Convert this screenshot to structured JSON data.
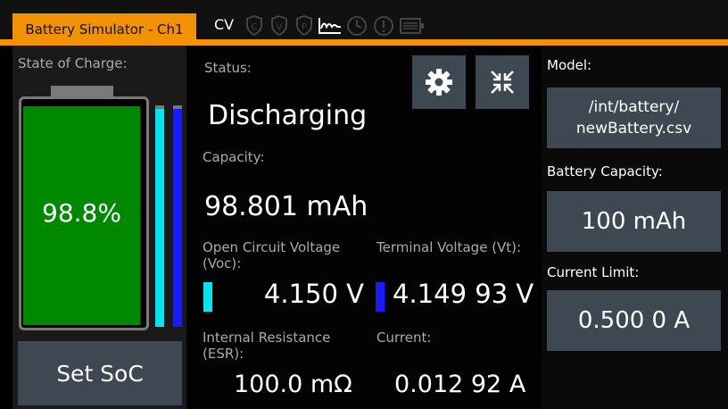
{
  "header": {
    "title": "Battery Simulator - Ch1",
    "mode": "CV"
  },
  "state_of_charge": {
    "label": "State of Charge:",
    "value": "98.8%",
    "level_percent": 98.8,
    "set_button": "Set SoC"
  },
  "status": {
    "label": "Status:",
    "value": "Discharging",
    "capacity_label": "Capacity:",
    "capacity_value": "98.801 mAh",
    "voc_label_line1": "Open Circuit Voltage",
    "voc_label_line2": "(Voc):",
    "voc_value": "4.150 V",
    "vt_label": "Terminal Voltage (Vt):",
    "vt_value": "4.149 93 V",
    "esr_label_line1": "Internal Resistance",
    "esr_label_line2": "(ESR):",
    "esr_value": "100.0 mΩ",
    "current_label": "Current:",
    "current_value": "0.012 92 A"
  },
  "model": {
    "label": "Model:",
    "path_line1": "/int/battery/",
    "path_line2": "newBattery.csv",
    "capacity_label": "Battery Capacity:",
    "capacity_value": "100 mAh",
    "current_limit_label": "Current Limit:",
    "current_limit_value": "0.500 0 A"
  },
  "colors": {
    "accent": "#f39200",
    "battery_fill": "#008800",
    "voc_indicator": "#00e5ee",
    "vt_indicator": "#1a1aff",
    "button_bg": "#3d4852"
  },
  "icons": [
    "shield-c-icon",
    "shield-v-icon",
    "shield-p-icon",
    "waveform-icon",
    "clock-icon",
    "warning-icon",
    "battery-icon",
    "gear-icon",
    "compress-icon"
  ]
}
